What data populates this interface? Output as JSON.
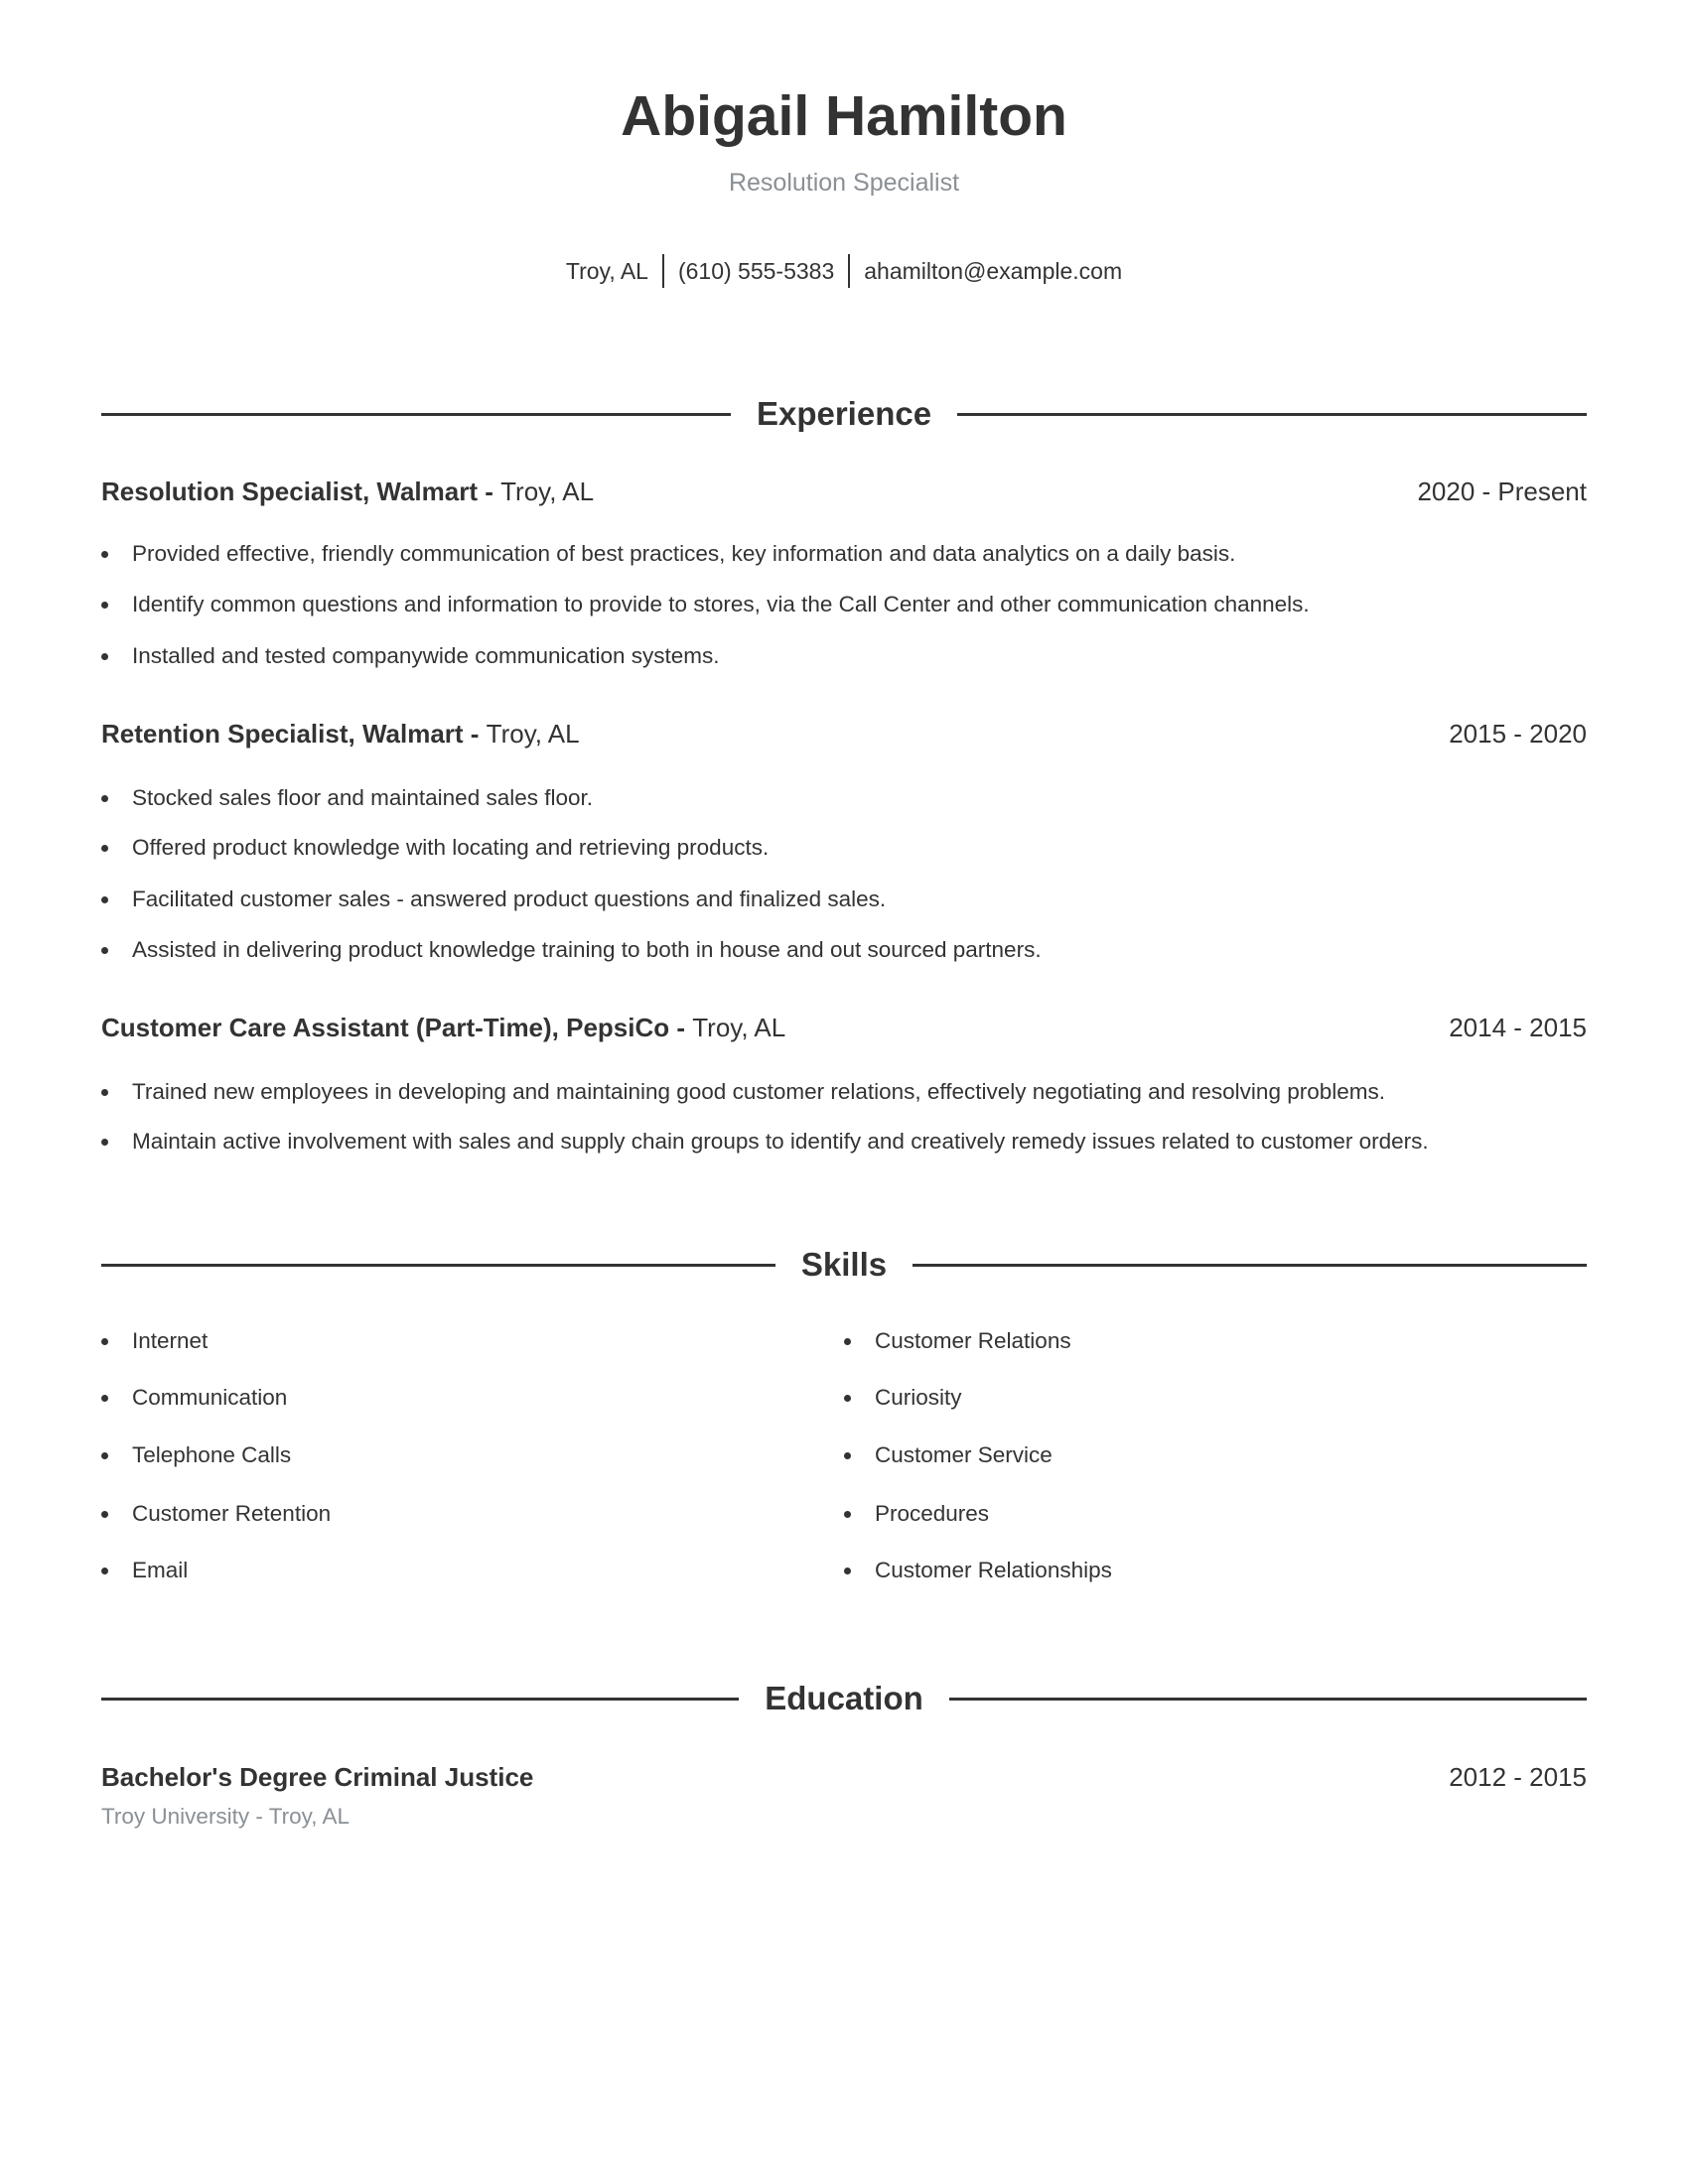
{
  "header": {
    "name": "Abigail Hamilton",
    "title": "Resolution Specialist",
    "contact": {
      "location": "Troy, AL",
      "phone": "(610) 555-5383",
      "email": "ahamilton@example.com"
    }
  },
  "experience": {
    "heading": "Experience",
    "jobs": [
      {
        "role": "Resolution Specialist, Walmart - ",
        "location": "Troy, AL",
        "dates": "2020 - Present",
        "bullets": [
          "Provided effective, friendly communication of best practices, key information and data analytics on a daily basis.",
          "Identify common questions and information to provide to stores, via the Call Center and other communication channels.",
          "Installed and tested companywide communication systems."
        ]
      },
      {
        "role": "Retention Specialist, Walmart - ",
        "location": "Troy, AL",
        "dates": "2015 - 2020",
        "bullets": [
          "Stocked sales floor and maintained sales floor.",
          "Offered product knowledge with locating and retrieving products.",
          "Facilitated customer sales - answered product questions and finalized sales.",
          "Assisted in delivering product knowledge training to both in house and out sourced partners."
        ]
      },
      {
        "role": "Customer Care Assistant (Part-Time), PepsiCo - ",
        "location": "Troy, AL",
        "dates": "2014 - 2015",
        "bullets": [
          "Trained new employees in developing and maintaining good customer relations, effectively negotiating and resolving problems.",
          "Maintain active involvement with sales and supply chain groups to identify and creatively remedy issues related to customer orders."
        ]
      }
    ]
  },
  "skills": {
    "heading": "Skills",
    "left": [
      "Internet",
      "Communication",
      "Telephone Calls",
      "Customer Retention",
      "Email"
    ],
    "right": [
      "Customer Relations",
      "Curiosity",
      "Customer Service",
      "Procedures",
      "Customer Relationships"
    ]
  },
  "education": {
    "heading": "Education",
    "degree": "Bachelor's Degree Criminal Justice",
    "dates": "2012 - 2015",
    "school": "Troy University - Troy, AL"
  },
  "colors": {
    "text": "#333333",
    "muted": "#8a9096",
    "background": "#ffffff"
  }
}
